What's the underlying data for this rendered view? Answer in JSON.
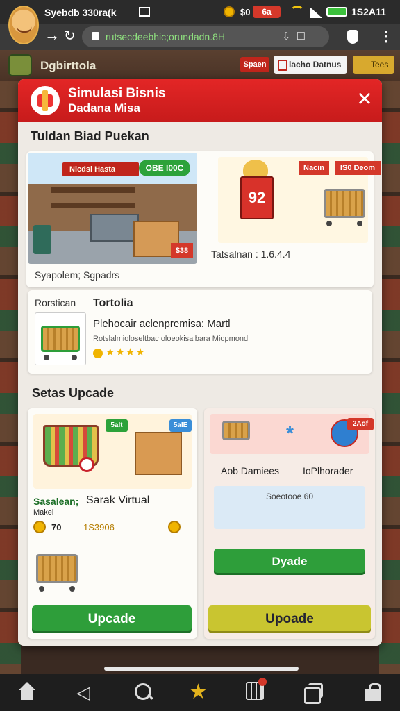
{
  "status_bar": {
    "title": "Syebdb 330ra(k",
    "coin_value": "$0",
    "red_badge": "6a",
    "time": "1S2A11"
  },
  "browser": {
    "url": "rutsecdeebhic;orundadn.8H",
    "back_icon": "arrow-left-icon",
    "reload_icon": "reload-icon"
  },
  "game_header": {
    "title": "Dgbirttola",
    "red_button": "Spaen",
    "white_button": "lacho Datnus",
    "yellow_button": "Tees"
  },
  "modal": {
    "title_line1": "Simulasi Bisnis",
    "title_line2": "Dadana Misa",
    "close_label": "✕"
  },
  "featured": {
    "section_title": "Tuldan Biad Puekan",
    "shop_sign": "Nlcdsl Hasta",
    "shop_badge": "OBE I00C",
    "shop_price": "$38",
    "shop_caption": "Syapolem;  Sgpadrs",
    "register_label": "92",
    "tag_a": "Nacin",
    "tag_b": "IS0 Deom",
    "cash_caption": "Tatsalnan : 1.6.4.4"
  },
  "portfolio": {
    "label": "Rorstican",
    "title": "Tortolia",
    "item_name": "Plehocair aclenpremisa: Martl",
    "item_desc": "Rotslalmioloseltbac oloeokisalbara Miopmond",
    "rating_stars": "★★★★"
  },
  "upgrade": {
    "section_title": "Setas Upcade",
    "left": {
      "chip_green": "5aIt",
      "chip_blue": "5aIE",
      "label": "Sasalean;",
      "name": "Sarak Virtual",
      "sub": "Makel",
      "coin_value": "70",
      "price": "1S3906",
      "button": "Upcade"
    },
    "right": {
      "chip_red": "2Aof",
      "col1": "Aob Damiees",
      "col2": "IoPlhorader",
      "info": "Soeotooe 60",
      "button_green": "Dyade",
      "button_yellow": "Upoade"
    }
  },
  "colors": {
    "accent_red": "#d62222",
    "green": "#2e9e3a",
    "yellow": "#c9c530"
  }
}
